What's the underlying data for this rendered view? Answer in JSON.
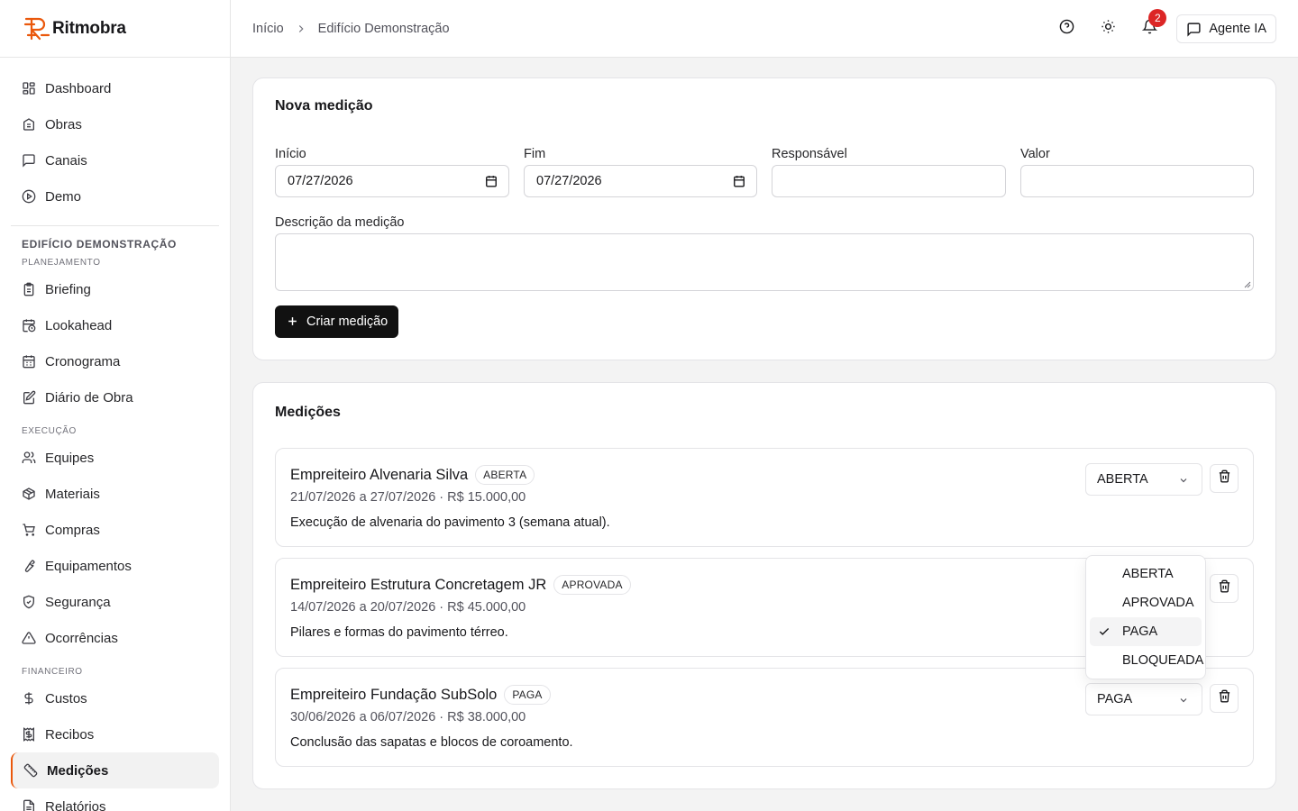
{
  "brand": {
    "name": "Ritmobra",
    "accent": "#ea580c"
  },
  "sidebar": {
    "top_items": [
      {
        "label": "Dashboard",
        "icon": "dashboard-icon"
      },
      {
        "label": "Obras",
        "icon": "building-icon"
      },
      {
        "label": "Canais",
        "icon": "message-icon"
      },
      {
        "label": "Demo",
        "icon": "play-icon"
      }
    ],
    "project_title": "EDIFÍCIO DEMONSTRAÇÃO",
    "sections": [
      {
        "label": "PLANEJAMENTO",
        "items": [
          {
            "label": "Briefing",
            "icon": "clipboard-icon"
          },
          {
            "label": "Lookahead",
            "icon": "calendar-clock-icon"
          },
          {
            "label": "Cronograma",
            "icon": "calendar-icon"
          },
          {
            "label": "Diário de Obra",
            "icon": "notebook-pen-icon"
          }
        ]
      },
      {
        "label": "EXECUÇÃO",
        "items": [
          {
            "label": "Equipes",
            "icon": "users-icon"
          },
          {
            "label": "Materiais",
            "icon": "package-icon"
          },
          {
            "label": "Compras",
            "icon": "cart-icon"
          },
          {
            "label": "Equipamentos",
            "icon": "wrench-icon"
          },
          {
            "label": "Segurança",
            "icon": "shield-icon"
          },
          {
            "label": "Ocorrências",
            "icon": "alert-triangle-icon"
          }
        ]
      },
      {
        "label": "FINANCEIRO",
        "items": [
          {
            "label": "Custos",
            "icon": "dollar-icon"
          },
          {
            "label": "Recibos",
            "icon": "receipt-icon"
          },
          {
            "label": "Medições",
            "icon": "ruler-icon",
            "active": true
          },
          {
            "label": "Relatórios",
            "icon": "file-icon"
          }
        ]
      }
    ]
  },
  "topbar": {
    "breadcrumb": [
      "Início",
      "Edifício Demonstração"
    ],
    "notifications_count": "2",
    "agent_label": "Agente IA"
  },
  "form": {
    "title": "Nova medição",
    "start_label": "Início",
    "start_value": "07/27/2026",
    "end_label": "Fim",
    "end_value": "07/27/2026",
    "responsible_label": "Responsável",
    "responsible_value": "",
    "value_label": "Valor",
    "value_value": "",
    "description_label": "Descrição da medição",
    "submit_label": "Criar medição"
  },
  "list": {
    "title": "Medições",
    "rows": [
      {
        "name": "Empreiteiro Alvenaria Silva",
        "status": "ABERTA",
        "meta": "21/07/2026 a 27/07/2026 · R$ 15.000,00",
        "description": "Execução de alvenaria do pavimento 3 (semana atual).",
        "select_value": "ABERTA"
      },
      {
        "name": "Empreiteiro Estrutura Concretagem JR",
        "status": "APROVADA",
        "meta": "14/07/2026 a 20/07/2026 · R$ 45.000,00",
        "description": "Pilares e formas do pavimento térreo.",
        "select_value": "APROVADA"
      },
      {
        "name": "Empreiteiro Fundação SubSolo",
        "status": "PAGA",
        "meta": "30/06/2026 a 06/07/2026 · R$ 38.000,00",
        "description": "Conclusão das sapatas e blocos de coroamento.",
        "select_value": "PAGA"
      }
    ]
  },
  "status_dropdown": {
    "options": [
      "ABERTA",
      "APROVADA",
      "PAGA",
      "BLOQUEADA"
    ],
    "selected": "PAGA"
  }
}
